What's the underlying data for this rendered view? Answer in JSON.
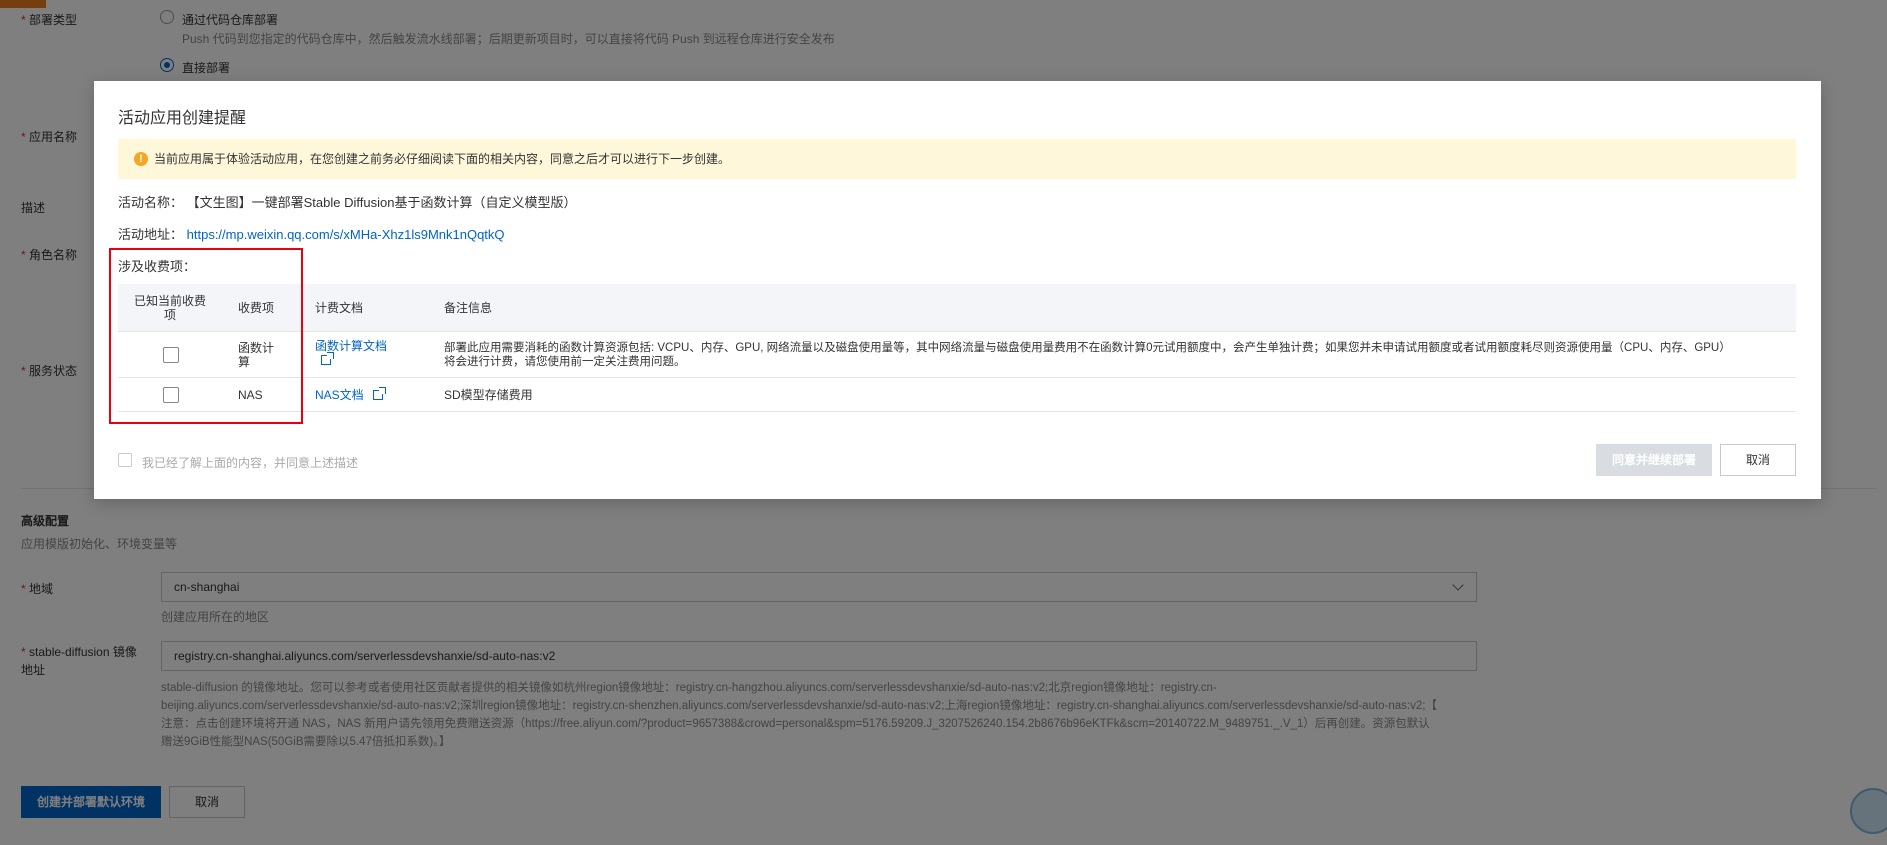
{
  "form": {
    "deploy_type_label": "部署类型",
    "deploy_option1": "通过代码仓库部署",
    "deploy_option1_hint": "Push 代码到您指定的代码仓库中，然后触发流水线部署；后期更新项目时，可以直接将代码 Push 到远程仓库进行安全发布",
    "deploy_option2": "直接部署",
    "app_name_label": "应用名称",
    "desc_label": "描述",
    "role_label": "角色名称",
    "service_status_label": "服务状态",
    "advanced_title": "高级配置",
    "advanced_sub": "应用模版初始化、环境变量等",
    "region_label": "地域",
    "region_value": "cn-shanghai",
    "region_hint": "创建应用所在的地区",
    "image_label_line1": "stable-diffusion 镜像",
    "image_label_line2": "地址",
    "image_value": "registry.cn-shanghai.aliyuncs.com/serverlessdevshanxie/sd-auto-nas:v2",
    "image_hint_line1": "stable-diffusion 的镜像地址。您可以参考或者使用社区贡献者提供的相关镜像如杭州region镜像地址：registry.cn-hangzhou.aliyuncs.com/serverlessdevshanxie/sd-auto-nas:v2;北京region镜像地址：registry.cn-",
    "image_hint_line2": "beijing.aliyuncs.com/serverlessdevshanxie/sd-auto-nas:v2;深圳region镜像地址：registry.cn-shenzhen.aliyuncs.com/serverlessdevshanxie/sd-auto-nas:v2;上海region镜像地址：registry.cn-shanghai.aliyuncs.com/serverlessdevshanxie/sd-auto-nas:v2;【",
    "image_hint_line3": "注意：点击创建环境将开通 NAS，NAS 新用户请先领用免费赠送资源（https://free.aliyun.com/?product=9657388&crowd=personal&spm=5176.59209.J_3207526240.154.2b8676b96eKTFk&scm=20140722.M_9489751._.V_1）后再创建。资源包默认",
    "image_hint_line4": "赠送9GiB性能型NAS(50GiB需要除以5.47倍抵扣系数)。】",
    "create_button": "创建并部署默认环境",
    "cancel_button": "取消"
  },
  "modal": {
    "title": "活动应用创建提醒",
    "warning": "当前应用属于体验活动应用，在您创建之前务必仔细阅读下面的相关内容，同意之后才可以进行下一步创建。",
    "activity_name_label": "活动名称：",
    "activity_name": "【文生图】一键部署Stable Diffusion基于函数计算（自定义模型版）",
    "activity_url_label": "活动地址：",
    "activity_url": "https://mp.weixin.qq.com/s/xMHa-Xhz1ls9Mnk1nQqtkQ",
    "fees_label": "涉及收费项：",
    "table": {
      "headers": [
        "已知当前收费项",
        "收费项",
        "计费文档",
        "备注信息"
      ],
      "rows": [
        {
          "item": "函数计算",
          "doc": "函数计算文档",
          "note_line1": "部署此应用需要消耗的函数计算资源包括: VCPU、内存、GPU, 网络流量以及磁盘使用量等，其中网络流量与磁盘使用量费用不在函数计算0元试用额度中，会产生单独计费；如果您并未申请试用额度或者试用额度耗尽则资源使用量（CPU、内存、GPU）",
          "note_line2": "将会进行计费，请您使用前一定关注费用问题。"
        },
        {
          "item": "NAS",
          "doc": "NAS文档",
          "note_line1": "SD模型存储费用",
          "note_line2": ""
        }
      ]
    },
    "agree_text": "我已经了解上面的内容，并同意上述描述",
    "agree_button": "同意并继续部署",
    "cancel_button": "取消"
  },
  "colors": {
    "primary": "#0064c8",
    "warning_bg": "#fff7d9",
    "highlight": "#e60012"
  }
}
